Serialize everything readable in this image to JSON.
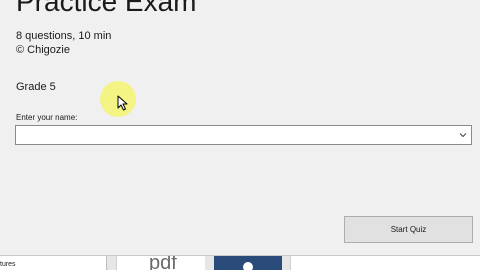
{
  "exam": {
    "title": "Practice Exam",
    "duration": "8 questions, 10 min",
    "author": "© Chigozie",
    "grade": "Grade 5"
  },
  "name_field": {
    "label": "Enter your name:",
    "value": "",
    "placeholder": ""
  },
  "start_button": {
    "label": "Start Quiz"
  },
  "background": {
    "left_panel_fragment": "tures",
    "pdf_fragment": "pdf"
  },
  "colors": {
    "dialog_bg": "#f0f0f0",
    "button_bg": "#e1e1e1",
    "cursor_highlight": "#f6f660",
    "background_tile_dark": "#2a4a7a"
  },
  "icons": {
    "dropdown": "chevron-down-icon",
    "cursor": "mouse-pointer-icon"
  }
}
